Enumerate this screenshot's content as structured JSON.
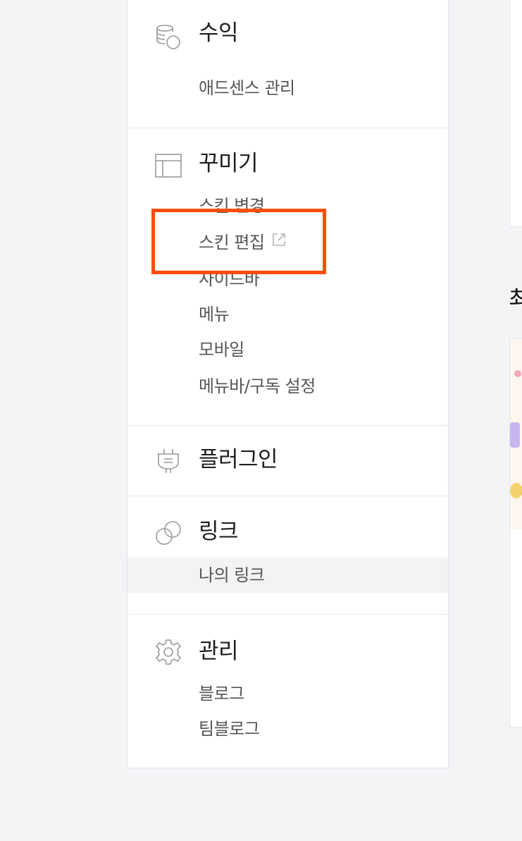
{
  "sidebar": {
    "sections": [
      {
        "title": "수익",
        "icon": "coins-icon",
        "items": [
          "애드센스 관리"
        ]
      },
      {
        "title": "꾸미기",
        "icon": "layout-icon",
        "items": [
          "스킨 변경",
          "스킨 편집",
          "사이드바",
          "메뉴",
          "모바일",
          "메뉴바/구독 설정"
        ]
      },
      {
        "title": "플러그인",
        "icon": "plug-icon",
        "items": []
      },
      {
        "title": "링크",
        "icon": "link-icon",
        "items": [
          "나의 링크"
        ]
      },
      {
        "title": "관리",
        "icon": "gear-icon",
        "items": [
          "블로그",
          "팀블로그"
        ]
      }
    ]
  },
  "right": {
    "heading": "최"
  },
  "colors": {
    "highlight": "#ff4c00",
    "active_item_bg": "#f2f3f5",
    "background": "#f3f4f6"
  }
}
